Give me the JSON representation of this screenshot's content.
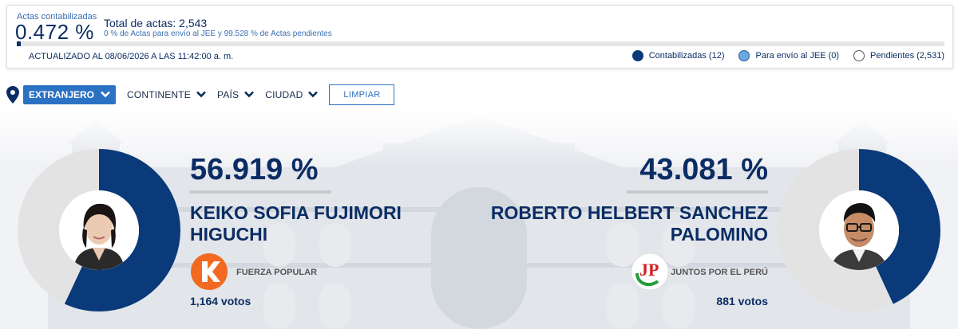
{
  "summary": {
    "actas_label": "Actas contabilizadas",
    "actas_percent": "0.472 %",
    "actas_progress_fraction": 0.00472,
    "total_actas": "Total de actas: 2,543",
    "detail": "0 % de Actas para envío al JEE y 99.528 % de Actas pendientes",
    "updated": "ACTUALIZADO AL 08/06/2026 A LAS 11:42:00 a. m."
  },
  "legend": [
    {
      "label": "Contabilizadas (12)",
      "color": "#0b3a7a"
    },
    {
      "label": "Para envío al JEE (0)",
      "color": "#6aa7e3"
    },
    {
      "label": "Pendientes (2,531)",
      "color": "#ffffff"
    }
  ],
  "filters": {
    "location_icon": "location-pin-icon",
    "active": "EXTRANJERO",
    "continent": "CONTINENTE",
    "country": "PAÍS",
    "city": "CIUDAD",
    "clear": "LIMPIAR"
  },
  "colors": {
    "primary": "#0b2d64",
    "accent": "#2c72c4",
    "ring_track": "#e3e3e3"
  },
  "candidates": [
    {
      "percent": "56.919 %",
      "share": 0.56919,
      "name_line1": "KEIKO SOFIA FUJIMORI",
      "name_line2": "HIGUCHI",
      "party": "FUERZA POPULAR",
      "party_logo_icon": "fuerza-popular-k-logo",
      "votes": "1,164 votos"
    },
    {
      "percent": "43.081 %",
      "share": 0.43081,
      "name_line1": "ROBERTO HELBERT SANCHEZ",
      "name_line2": "PALOMINO",
      "party": "JUNTOS POR EL PERÚ",
      "party_logo_icon": "juntos-por-el-peru-jp-logo",
      "votes": "881 votos"
    }
  ]
}
